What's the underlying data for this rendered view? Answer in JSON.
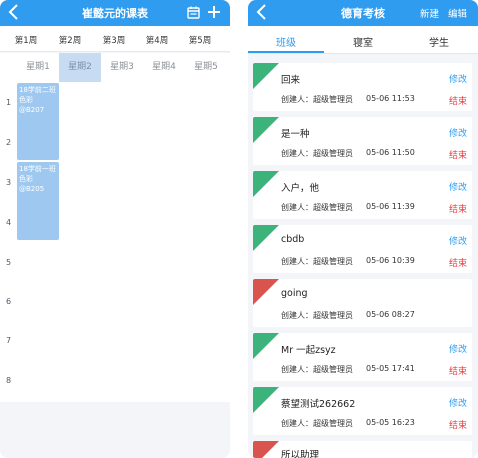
{
  "schedule": {
    "title": "崔懿元的课表",
    "weeks": [
      "第1周",
      "第2周",
      "第3周",
      "第4周",
      "第5周"
    ],
    "days": [
      "星期1",
      "星期2",
      "星期3",
      "星期4",
      "星期5"
    ],
    "active_day": "星期2",
    "periods": [
      "1",
      "2",
      "3",
      "4",
      "5",
      "6",
      "7",
      "8"
    ],
    "courses": [
      {
        "text": "18学前二班 色彩@B207"
      },
      {
        "text": "18学前一班 色彩@B205"
      }
    ]
  },
  "moral": {
    "title": "德育考核",
    "new_label": "新建",
    "edit_label": "编辑",
    "tabs": [
      "班级",
      "寝室",
      "学生"
    ],
    "active_tab": "班级",
    "colors": {
      "accent": "#2f9cf0",
      "ongoing": "#3bb37a",
      "ended": "#d9534f",
      "end_text": "#e83f3f"
    },
    "items": [
      {
        "title": "回来",
        "creator": "创建人：超级管理员",
        "date": "05-06 11:53",
        "status": "进行中",
        "edit": "修改",
        "action": "结束"
      },
      {
        "title": "是一种",
        "creator": "创建人：超级管理员",
        "date": "05-06 11:50",
        "status": "进行中",
        "edit": "修改",
        "action": "结束"
      },
      {
        "title": "入户，他",
        "creator": "创建人：超级管理员",
        "date": "05-06 11:39",
        "status": "进行中",
        "edit": "修改",
        "action": "结束"
      },
      {
        "title": "cbdb",
        "creator": "创建人：超级管理员",
        "date": "05-06 10:39",
        "status": "进行中",
        "edit": "修改",
        "action": "结束"
      },
      {
        "title": "going",
        "creator": "创建人：超级管理员",
        "date": "05-06 08:27",
        "status": "已结束",
        "edit": "",
        "action": ""
      },
      {
        "title": "Mr 一起zsyz",
        "creator": "创建人：超级管理员",
        "date": "05-05 17:41",
        "status": "进行中",
        "edit": "修改",
        "action": "结束"
      },
      {
        "title": "蔡望测试262662",
        "creator": "创建人：超级管理员",
        "date": "05-05 16:23",
        "status": "进行中",
        "edit": "修改",
        "action": "结束"
      },
      {
        "title": "所以助理",
        "creator": "",
        "date": "",
        "status": "已结束",
        "edit": "",
        "action": ""
      }
    ]
  }
}
